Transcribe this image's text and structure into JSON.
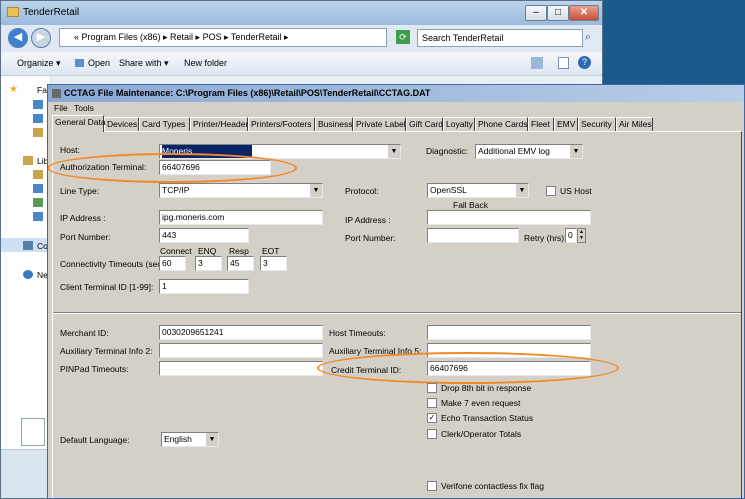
{
  "explorer": {
    "title": "TenderRetail",
    "address_path": "« Program Files (x86) ▸ Retail ▸ POS ▸ TenderRetail ▸",
    "search_placeholder": "Search TenderRetail",
    "toolbar": {
      "organize": "Organize ▾",
      "open": "Open",
      "share_with": "Share with ▾",
      "new_folder": "New folder"
    },
    "nav_items": [
      "Fa",
      "Lib",
      "Co",
      "Ne"
    ]
  },
  "dialog": {
    "title": "CCTAG File Maintenance: C:\\Program Files (x86)\\Retail\\POS\\TenderRetail\\CCTAG.DAT",
    "menu": {
      "file": "File",
      "tools": "Tools"
    },
    "tabs": [
      "General Data",
      "Devices",
      "Card Types",
      "Printer/Header",
      "Printers/Footers",
      "Business",
      "Private Label",
      "Gift Card",
      "Loyalty",
      "Phone Cards",
      "Fleet",
      "EMV",
      "Security",
      "Air Miles"
    ],
    "host": {
      "label": "Host:",
      "value": "Moneris"
    },
    "diagnostic": {
      "label": "Diagnostic:",
      "value": "Additional EMV log"
    },
    "auth_terminal": {
      "label": "Authorization Terminal:",
      "value": "66407696"
    },
    "line_type": {
      "label": "Line Type:",
      "value": "TCP/IP"
    },
    "protocol": {
      "label": "Protocol:",
      "value": "OpenSSL"
    },
    "us_host": {
      "label": "US Host"
    },
    "fall_back": "Fall Back",
    "ip_address": {
      "label": "IP Address :",
      "value": "ipg.moneris.com"
    },
    "ip_address_fb": {
      "label": "IP Address :",
      "value": ""
    },
    "port_number": {
      "label": "Port Number:",
      "value": "443"
    },
    "port_number_fb": {
      "label": "Port Number:",
      "value": ""
    },
    "retry": {
      "label": "Retry (hrs):",
      "value": "0"
    },
    "timeouts": {
      "label": "Connectivity Timeouts (sec):",
      "headers": [
        "Connect",
        "ENQ",
        "Resp",
        "EOT"
      ],
      "values": [
        "60",
        "3",
        "45",
        "3"
      ]
    },
    "client_terminal": {
      "label": "Client Terminal ID [1-99]:",
      "value": "1"
    },
    "merchant_id": {
      "label": "Merchant ID:",
      "value": "0030209651241"
    },
    "host_timeouts": {
      "label": "Host Timeouts:",
      "value": ""
    },
    "aux_info2": {
      "label": "Auxiliary Terminal Info 2:",
      "value": ""
    },
    "aux_info5": {
      "label": "Auxiliary Terminal Info 5:",
      "value": ""
    },
    "pinpad_timeouts": {
      "label": "PINPad Timeouts:",
      "value": ""
    },
    "credit_terminal": {
      "label": "Credit Terminal ID:",
      "value": "66407696"
    },
    "checks": [
      {
        "label": "Drop 8th bit in response",
        "checked": false
      },
      {
        "label": "Make 7 even request",
        "checked": false
      },
      {
        "label": "Echo Transaction Status",
        "checked": true
      },
      {
        "label": "Clerk/Operator Totals",
        "checked": false
      }
    ],
    "default_language": {
      "label": "Default Language:",
      "value": "English"
    },
    "verifone": {
      "label": "Verifone contactless fix flag"
    }
  },
  "colors": {
    "highlight_ring": "#f08a26",
    "selection": "#0a246a",
    "dialog_face": "#d4d0c8"
  }
}
